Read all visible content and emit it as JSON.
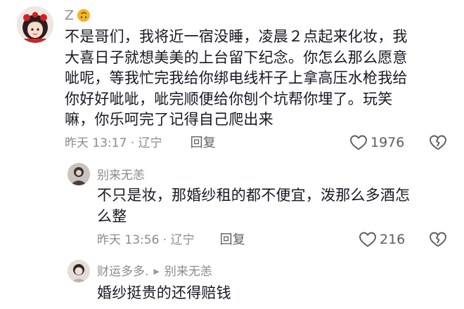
{
  "comment": {
    "username": "Z",
    "emoji_badge": "upside-down-face-icon",
    "text_lines": [
      "不是哥们，我将近一宿没睡，凌晨２点起来化妆，我",
      "大喜日子就想美美的上台留下纪念。你怎么那么愿意",
      "呲呢，等我忙完我给你绑电线杆子上拿高压水枪我给",
      "你好好呲呲，呲完顺便给你刨个坑帮你埋了。玩笑",
      "嘛，你乐呵完了记得自己爬出来"
    ],
    "time": "昨天 13:17 · 辽宁",
    "reply_label": "回复",
    "like_count": "1976"
  },
  "replies": [
    {
      "username": "别来无恙",
      "text_lines": [
        "不只是妆，那婚纱租的都不便宜，泼那么多酒怎",
        "么整"
      ],
      "time": "昨天 13:56 · 辽宁",
      "reply_label": "回复",
      "like_count": "216"
    },
    {
      "username": "财运多多.",
      "reply_to": "别来无恙",
      "text_lines": [
        "婚纱挺贵的还得赔钱"
      ]
    }
  ],
  "colors": {
    "text": "#161823",
    "secondary": "#8a8b91",
    "accent_red": "#d81e1e"
  }
}
